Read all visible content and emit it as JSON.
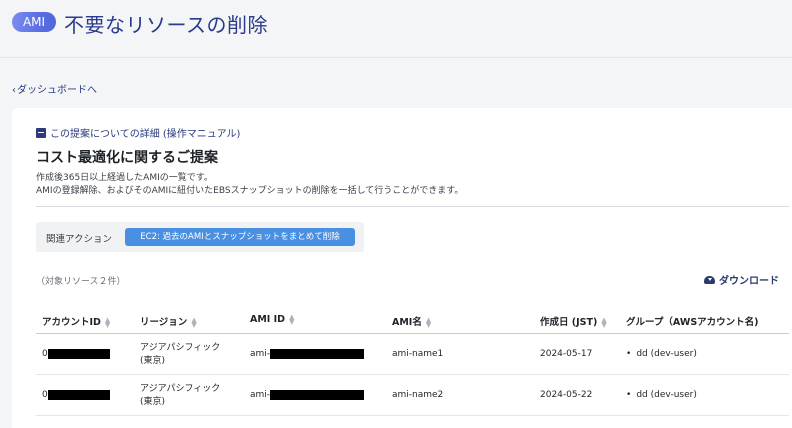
{
  "header": {
    "badge": "AMI",
    "title": "不要なリソースの削除"
  },
  "nav": {
    "back_label": "ダッシュボードへ"
  },
  "proposal": {
    "manual_link": "この提案についての詳細 (操作マニュアル)",
    "title": "コスト最適化に関するご提案",
    "description_line1": "作成後365日以上経過したAMIの一覧です。",
    "description_line2": "AMIの登録解除、およびそのAMIに紐付いたEBSスナップショットの削除を一括して行うことができます。"
  },
  "related_action": {
    "label": "関連アクション",
    "button_label": "EC2: 過去のAMIとスナップショットをまとめて削除"
  },
  "table": {
    "count_label": "（対象リソース２件）",
    "download_label": "ダウンロード",
    "columns": [
      "アカウントID",
      "リージョン",
      "AMI ID",
      "AMI名",
      "作成日 (JST)",
      "グループ（AWSアカウント名)"
    ],
    "rows": [
      {
        "account_prefix": "0",
        "region_line1": "アジアパシフィック",
        "region_line2": "(東京)",
        "ami_prefix": "ami-",
        "ami_name": "ami-name1",
        "created": "2024-05-17",
        "group": "dd (dev-user)"
      },
      {
        "account_prefix": "0",
        "region_line1": "アジアパシフィック",
        "region_line2": "(東京)",
        "ami_prefix": "ami-",
        "ami_name": "ami-name2",
        "created": "2024-05-22",
        "group": "dd (dev-user)"
      }
    ]
  }
}
